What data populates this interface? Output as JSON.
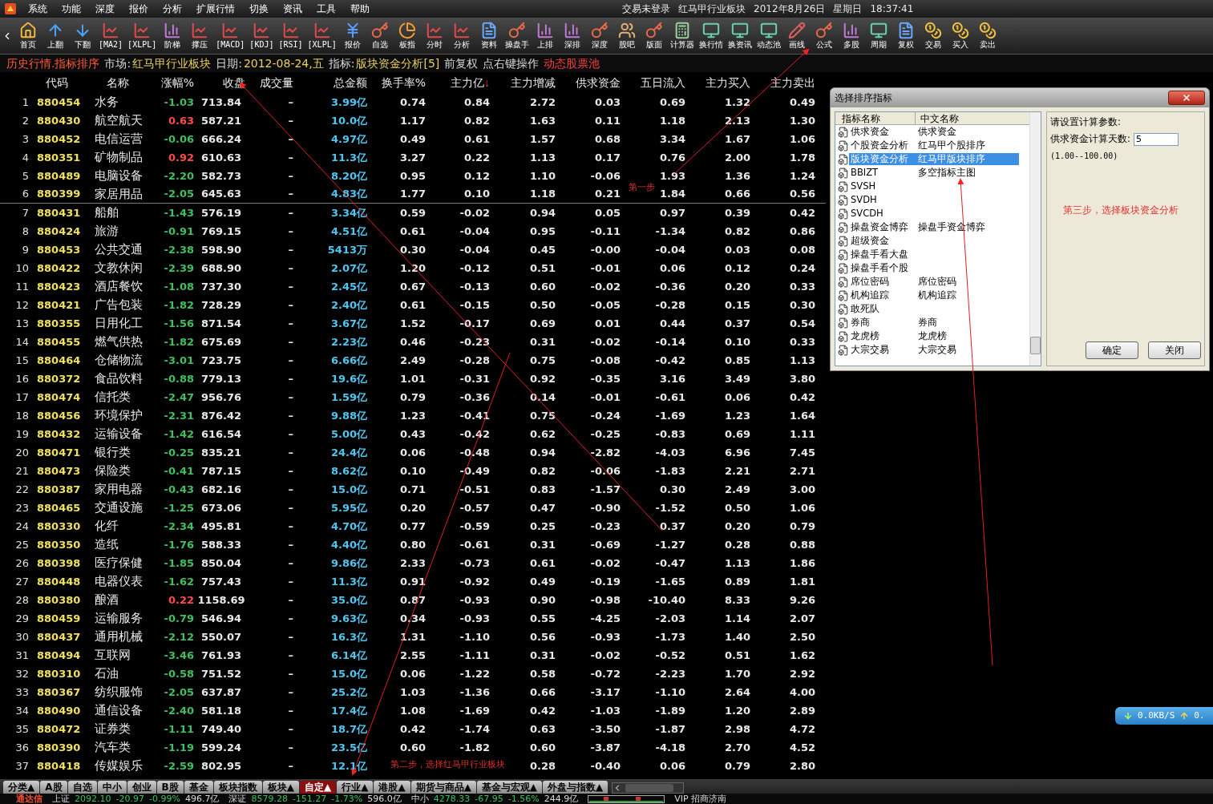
{
  "menu": [
    "系统",
    "功能",
    "深度",
    "报价",
    "分析",
    "扩展行情",
    "切换",
    "资讯",
    "工具",
    "帮助"
  ],
  "title_bar": {
    "login": "交易未登录",
    "board": "红马甲行业板块",
    "date": "2012年8月26日",
    "weekday": "星期日",
    "time": "18:37:41"
  },
  "toolbar": [
    {
      "label": "首页",
      "kind": "home"
    },
    {
      "label": "上翻",
      "kind": "up"
    },
    {
      "label": "下翻",
      "kind": "down"
    },
    {
      "label": "[MA2]",
      "kind": "line"
    },
    {
      "label": "[XLPL]",
      "kind": "line"
    },
    {
      "label": "阶梯",
      "kind": "bar"
    },
    {
      "label": "撑压",
      "kind": "line"
    },
    {
      "label": "[MACD]",
      "kind": "line"
    },
    {
      "label": "[KDJ]",
      "kind": "line"
    },
    {
      "label": "[RSI]",
      "kind": "line"
    },
    {
      "label": "[XLPL]",
      "kind": "line"
    },
    {
      "label": "报价",
      "kind": "yen"
    },
    {
      "label": "自选",
      "kind": "key"
    },
    {
      "label": "板指",
      "kind": "pie"
    },
    {
      "label": "分时",
      "kind": "line"
    },
    {
      "label": "分析",
      "kind": "line"
    },
    {
      "label": "资料",
      "kind": "doc"
    },
    {
      "label": "操盘手",
      "kind": "key"
    },
    {
      "label": "上排",
      "kind": "bar"
    },
    {
      "label": "深排",
      "kind": "bar"
    },
    {
      "label": "深度",
      "kind": "key"
    },
    {
      "label": "股吧",
      "kind": "people"
    },
    {
      "label": "版面",
      "kind": "key"
    },
    {
      "label": "计算器",
      "kind": "calc"
    },
    {
      "label": "换行情",
      "kind": "monitor"
    },
    {
      "label": "换资讯",
      "kind": "monitor"
    },
    {
      "label": "动态池",
      "kind": "monitor"
    },
    {
      "label": "画线",
      "kind": "pen"
    },
    {
      "label": "公式",
      "kind": "key"
    },
    {
      "label": "多股",
      "kind": "bar"
    },
    {
      "label": "周期",
      "kind": "monitor"
    },
    {
      "label": "复权",
      "kind": "doc"
    },
    {
      "label": "交易",
      "kind": "coins"
    },
    {
      "label": "买入",
      "kind": "coins"
    },
    {
      "label": "卖出",
      "kind": "coins"
    }
  ],
  "info_line": {
    "mode": "历史行情.指标排序",
    "market_label": "市场:",
    "market": "红马甲行业板块",
    "date_label": "日期:",
    "date": "2012-08-24,五",
    "indicator_label": "指标:",
    "indicator": "版块资金分析[5]",
    "adjust": "前复权",
    "hint": "点右键操作",
    "pool": "动态股票池"
  },
  "table": {
    "columns": [
      {
        "label": "代码"
      },
      {
        "label": "名称"
      },
      {
        "label": "涨幅%"
      },
      {
        "label": "收盘"
      },
      {
        "label": "成交量"
      },
      {
        "label": "总金额"
      },
      {
        "label": "换手率%"
      },
      {
        "label": "主力亿",
        "sort_mark": "↓"
      },
      {
        "label": "主力增减"
      },
      {
        "label": "供求资金"
      },
      {
        "label": "五日流入"
      },
      {
        "label": "主力买入"
      },
      {
        "label": "主力卖出"
      }
    ],
    "rows": [
      {
        "n": "1",
        "up": false,
        "cells": [
          "880454",
          "水务",
          "-1.03",
          "713.84",
          "–",
          "3.99亿",
          "0.74",
          "0.84",
          "2.72",
          "0.03",
          "0.69",
          "1.32",
          "0.49"
        ]
      },
      {
        "n": "2",
        "up": true,
        "cells": [
          "880430",
          "航空航天",
          "0.63",
          "587.21",
          "–",
          "10.0亿",
          "1.17",
          "0.82",
          "1.63",
          "0.11",
          "1.18",
          "2.13",
          "1.30"
        ]
      },
      {
        "n": "3",
        "up": false,
        "cells": [
          "880452",
          "电信运营",
          "-0.06",
          "666.24",
          "–",
          "4.97亿",
          "0.49",
          "0.61",
          "1.57",
          "0.68",
          "3.34",
          "1.67",
          "1.06"
        ]
      },
      {
        "n": "4",
        "up": true,
        "cells": [
          "880351",
          "矿物制品",
          "0.92",
          "610.63",
          "–",
          "11.3亿",
          "3.27",
          "0.22",
          "1.13",
          "0.17",
          "0.76",
          "2.00",
          "1.78"
        ]
      },
      {
        "n": "5",
        "up": false,
        "cells": [
          "880489",
          "电脑设备",
          "-2.20",
          "582.73",
          "–",
          "8.20亿",
          "0.95",
          "0.12",
          "1.10",
          "-0.06",
          "1.93",
          "1.36",
          "1.24"
        ]
      },
      {
        "n": "6",
        "up": false,
        "cells": [
          "880399",
          "家居用品",
          "-2.05",
          "645.63",
          "–",
          "4.83亿",
          "1.77",
          "0.10",
          "1.18",
          "0.21",
          "1.84",
          "0.66",
          "0.56"
        ]
      },
      {
        "n": "7",
        "up": false,
        "cells": [
          "880431",
          "船舶",
          "-1.43",
          "576.19",
          "–",
          "3.34亿",
          "0.59",
          "-0.02",
          "0.94",
          "0.05",
          "0.97",
          "0.39",
          "0.42"
        ]
      },
      {
        "n": "8",
        "up": false,
        "cells": [
          "880424",
          "旅游",
          "-0.91",
          "769.15",
          "–",
          "4.51亿",
          "0.61",
          "-0.04",
          "0.95",
          "-0.11",
          "-1.34",
          "0.82",
          "0.86"
        ]
      },
      {
        "n": "9",
        "up": false,
        "cells": [
          "880453",
          "公共交通",
          "-2.38",
          "598.90",
          "–",
          "5413万",
          "0.30",
          "-0.04",
          "0.45",
          "-0.00",
          "-0.04",
          "0.03",
          "0.08"
        ]
      },
      {
        "n": "10",
        "up": false,
        "cells": [
          "880422",
          "文教休闲",
          "-2.39",
          "688.90",
          "–",
          "2.07亿",
          "1.20",
          "-0.12",
          "0.51",
          "-0.01",
          "0.06",
          "0.12",
          "0.24"
        ]
      },
      {
        "n": "11",
        "up": false,
        "cells": [
          "880423",
          "酒店餐饮",
          "-1.08",
          "737.30",
          "–",
          "2.45亿",
          "0.67",
          "-0.13",
          "0.60",
          "-0.02",
          "-0.36",
          "0.20",
          "0.33"
        ]
      },
      {
        "n": "12",
        "up": false,
        "cells": [
          "880421",
          "广告包装",
          "-1.82",
          "728.29",
          "–",
          "2.40亿",
          "0.61",
          "-0.15",
          "0.50",
          "-0.05",
          "-0.28",
          "0.15",
          "0.30"
        ]
      },
      {
        "n": "13",
        "up": false,
        "cells": [
          "880355",
          "日用化工",
          "-1.56",
          "871.54",
          "–",
          "3.67亿",
          "1.52",
          "-0.17",
          "0.69",
          "0.01",
          "0.44",
          "0.37",
          "0.54"
        ]
      },
      {
        "n": "14",
        "up": false,
        "cells": [
          "880455",
          "燃气供热",
          "-1.82",
          "675.69",
          "–",
          "2.23亿",
          "0.46",
          "-0.23",
          "0.31",
          "-0.02",
          "-0.14",
          "0.10",
          "0.33"
        ]
      },
      {
        "n": "15",
        "up": false,
        "cells": [
          "880464",
          "仓储物流",
          "-3.01",
          "723.75",
          "–",
          "6.66亿",
          "2.49",
          "-0.28",
          "0.75",
          "-0.08",
          "-0.42",
          "0.85",
          "1.13"
        ]
      },
      {
        "n": "16",
        "up": false,
        "cells": [
          "880372",
          "食品饮料",
          "-0.88",
          "779.13",
          "–",
          "19.6亿",
          "1.01",
          "-0.31",
          "0.92",
          "-0.35",
          "3.16",
          "3.49",
          "3.80"
        ]
      },
      {
        "n": "17",
        "up": false,
        "cells": [
          "880474",
          "信托类",
          "-2.47",
          "956.76",
          "–",
          "1.59亿",
          "0.79",
          "-0.36",
          "0.14",
          "-0.01",
          "-0.61",
          "0.06",
          "0.42"
        ]
      },
      {
        "n": "18",
        "up": false,
        "cells": [
          "880456",
          "环境保护",
          "-2.31",
          "876.42",
          "–",
          "9.88亿",
          "1.23",
          "-0.41",
          "0.75",
          "-0.24",
          "-1.69",
          "1.23",
          "1.64"
        ]
      },
      {
        "n": "19",
        "up": false,
        "cells": [
          "880432",
          "运输设备",
          "-1.42",
          "616.54",
          "–",
          "5.00亿",
          "0.43",
          "-0.42",
          "0.62",
          "-0.25",
          "-0.83",
          "0.69",
          "1.11"
        ]
      },
      {
        "n": "20",
        "up": false,
        "cells": [
          "880471",
          "银行类",
          "-0.25",
          "835.21",
          "–",
          "24.4亿",
          "0.06",
          "-0.48",
          "0.94",
          "-2.82",
          "-4.03",
          "6.96",
          "7.45"
        ]
      },
      {
        "n": "21",
        "up": false,
        "cells": [
          "880473",
          "保险类",
          "-0.41",
          "787.15",
          "–",
          "8.62亿",
          "0.10",
          "-0.49",
          "0.82",
          "-0.06",
          "-1.83",
          "2.21",
          "2.71"
        ]
      },
      {
        "n": "22",
        "up": false,
        "cells": [
          "880387",
          "家用电器",
          "-0.43",
          "682.16",
          "–",
          "15.0亿",
          "0.71",
          "-0.51",
          "0.83",
          "-1.57",
          "0.30",
          "2.49",
          "3.00"
        ]
      },
      {
        "n": "23",
        "up": false,
        "cells": [
          "880465",
          "交通设施",
          "-1.25",
          "673.06",
          "–",
          "5.95亿",
          "0.20",
          "-0.57",
          "0.47",
          "-0.90",
          "-1.52",
          "0.50",
          "1.06"
        ]
      },
      {
        "n": "24",
        "up": false,
        "cells": [
          "880330",
          "化纤",
          "-2.34",
          "495.81",
          "–",
          "4.70亿",
          "0.77",
          "-0.59",
          "0.25",
          "-0.23",
          "0.37",
          "0.20",
          "0.79"
        ]
      },
      {
        "n": "25",
        "up": false,
        "cells": [
          "880350",
          "造纸",
          "-1.76",
          "588.33",
          "–",
          "4.40亿",
          "0.80",
          "-0.61",
          "0.31",
          "-0.69",
          "-1.27",
          "0.28",
          "0.88"
        ]
      },
      {
        "n": "26",
        "up": false,
        "cells": [
          "880398",
          "医疗保健",
          "-1.85",
          "850.04",
          "–",
          "9.86亿",
          "2.33",
          "-0.73",
          "0.61",
          "-0.02",
          "-0.47",
          "1.13",
          "1.86"
        ]
      },
      {
        "n": "27",
        "up": false,
        "cells": [
          "880448",
          "电器仪表",
          "-1.62",
          "757.43",
          "–",
          "11.3亿",
          "0.91",
          "-0.92",
          "0.49",
          "-0.19",
          "-1.65",
          "0.89",
          "1.81"
        ]
      },
      {
        "n": "28",
        "up": true,
        "cells": [
          "880380",
          "酿酒",
          "0.22",
          "1158.69",
          "–",
          "35.0亿",
          "0.87",
          "-0.93",
          "0.90",
          "-0.98",
          "-10.40",
          "8.33",
          "9.26"
        ]
      },
      {
        "n": "29",
        "up": false,
        "cells": [
          "880459",
          "运输服务",
          "-0.79",
          "546.94",
          "–",
          "9.63亿",
          "0.34",
          "-0.93",
          "0.55",
          "-4.25",
          "-2.03",
          "1.14",
          "2.07"
        ]
      },
      {
        "n": "30",
        "up": false,
        "cells": [
          "880437",
          "通用机械",
          "-2.12",
          "550.07",
          "–",
          "16.3亿",
          "1.31",
          "-1.10",
          "0.56",
          "-0.93",
          "-1.73",
          "1.40",
          "2.50"
        ]
      },
      {
        "n": "31",
        "up": false,
        "cells": [
          "880494",
          "互联网",
          "-3.46",
          "761.93",
          "–",
          "6.14亿",
          "2.55",
          "-1.11",
          "0.31",
          "-0.02",
          "-0.52",
          "0.51",
          "1.62"
        ]
      },
      {
        "n": "32",
        "up": false,
        "cells": [
          "880310",
          "石油",
          "-0.58",
          "751.52",
          "–",
          "15.0亿",
          "0.06",
          "-1.22",
          "0.58",
          "-0.72",
          "-2.23",
          "1.70",
          "2.92"
        ]
      },
      {
        "n": "33",
        "up": false,
        "cells": [
          "880367",
          "纺织服饰",
          "-2.05",
          "637.87",
          "–",
          "25.2亿",
          "1.03",
          "-1.36",
          "0.66",
          "-3.17",
          "-1.10",
          "2.64",
          "4.00"
        ]
      },
      {
        "n": "34",
        "up": false,
        "cells": [
          "880490",
          "通信设备",
          "-2.40",
          "581.18",
          "–",
          "17.4亿",
          "1.08",
          "-1.69",
          "0.42",
          "-1.03",
          "-1.89",
          "1.20",
          "2.89"
        ]
      },
      {
        "n": "35",
        "up": false,
        "cells": [
          "880472",
          "证券类",
          "-1.11",
          "749.40",
          "–",
          "18.7亿",
          "0.42",
          "-1.74",
          "0.63",
          "-3.50",
          "-1.87",
          "2.98",
          "4.72"
        ]
      },
      {
        "n": "36",
        "up": false,
        "cells": [
          "880390",
          "汽车类",
          "-1.19",
          "599.24",
          "–",
          "23.5亿",
          "0.60",
          "-1.82",
          "0.60",
          "-3.87",
          "-4.18",
          "2.70",
          "4.52"
        ]
      },
      {
        "n": "37",
        "up": false,
        "cells": [
          "880418",
          "传媒娱乐",
          "-2.59",
          "802.95",
          "–",
          "12.1亿",
          null,
          null,
          "0.28",
          "-0.40",
          "0.06",
          "0.79",
          "2.80"
        ]
      }
    ]
  },
  "annotations": [
    "第一步",
    "第二步，选择红马甲行业板块"
  ],
  "dialog": {
    "title": "选择排序指标",
    "list_columns": [
      "指标名称",
      "中文名称"
    ],
    "items": [
      {
        "name": "供求资金",
        "cn": "供求资金",
        "selected": false
      },
      {
        "name": "个股资金分析",
        "cn": "红马甲个股排序",
        "selected": false
      },
      {
        "name": "版块资金分析",
        "cn": "红马甲版块排序",
        "selected": true
      },
      {
        "name": "BBIZT",
        "cn": "多空指标主图",
        "selected": false
      },
      {
        "name": "SVSH",
        "selected": false
      },
      {
        "name": "SVDH",
        "selected": false
      },
      {
        "name": "SVCDH",
        "selected": false
      },
      {
        "name": "操盘资金博弈",
        "cn": "操盘手资金博弈",
        "selected": false
      },
      {
        "name": "超级资金",
        "selected": false
      },
      {
        "name": "操盘手看大盘",
        "selected": false
      },
      {
        "name": "操盘手看个股",
        "selected": false
      },
      {
        "name": "席位密码",
        "cn": "席位密码",
        "selected": false
      },
      {
        "name": "机构追踪",
        "cn": "机构追踪",
        "selected": false
      },
      {
        "name": "敢死队",
        "selected": false
      },
      {
        "name": "券商",
        "cn": "券商",
        "selected": false
      },
      {
        "name": "龙虎榜",
        "cn": "龙虎榜",
        "selected": false
      },
      {
        "name": "大宗交易",
        "cn": "大宗交易",
        "selected": false
      }
    ],
    "prompt": "请设置计算参数:",
    "param_label": "供求资金计算天数:",
    "param_value": "5",
    "range": "(1.00--100.00)",
    "note": "第三步，选择板块资金分析",
    "buttons": [
      "确定",
      "关闭"
    ]
  },
  "net_speed": {
    "down": "0.0KB/S",
    "up": "0."
  },
  "bottom_tabs": [
    {
      "label": "分类▲",
      "selected": false
    },
    {
      "label": "A股",
      "selected": false
    },
    {
      "label": "自选",
      "selected": false
    },
    {
      "label": "中小",
      "selected": false
    },
    {
      "label": "创业",
      "selected": false
    },
    {
      "label": "B股",
      "selected": false
    },
    {
      "label": "基金",
      "selected": false
    },
    {
      "label": "板块指数",
      "selected": false
    },
    {
      "label": "板块▲",
      "selected": false
    },
    {
      "label": "自定▲",
      "selected": true
    },
    {
      "label": "行业▲",
      "selected": false
    },
    {
      "label": "港股▲",
      "selected": false
    },
    {
      "label": "期货与商品▲",
      "selected": false
    },
    {
      "label": "基金与宏观▲",
      "selected": false
    },
    {
      "label": "外盘与指数▲",
      "selected": false
    }
  ],
  "status_bar": {
    "brand": "通达信",
    "indices": [
      {
        "name": "上证",
        "value": "2092.10",
        "change": "-20.97",
        "pct": "-0.99%",
        "amount": "496.7亿"
      },
      {
        "name": "深证",
        "value": "8579.28",
        "change": "-151.27",
        "pct": "-1.73%",
        "amount": "596.0亿"
      },
      {
        "name": "中小",
        "value": "4278.33",
        "change": "-67.95",
        "pct": "-1.56%",
        "amount": "244.9亿"
      }
    ],
    "server": "VIP 招商济南"
  }
}
